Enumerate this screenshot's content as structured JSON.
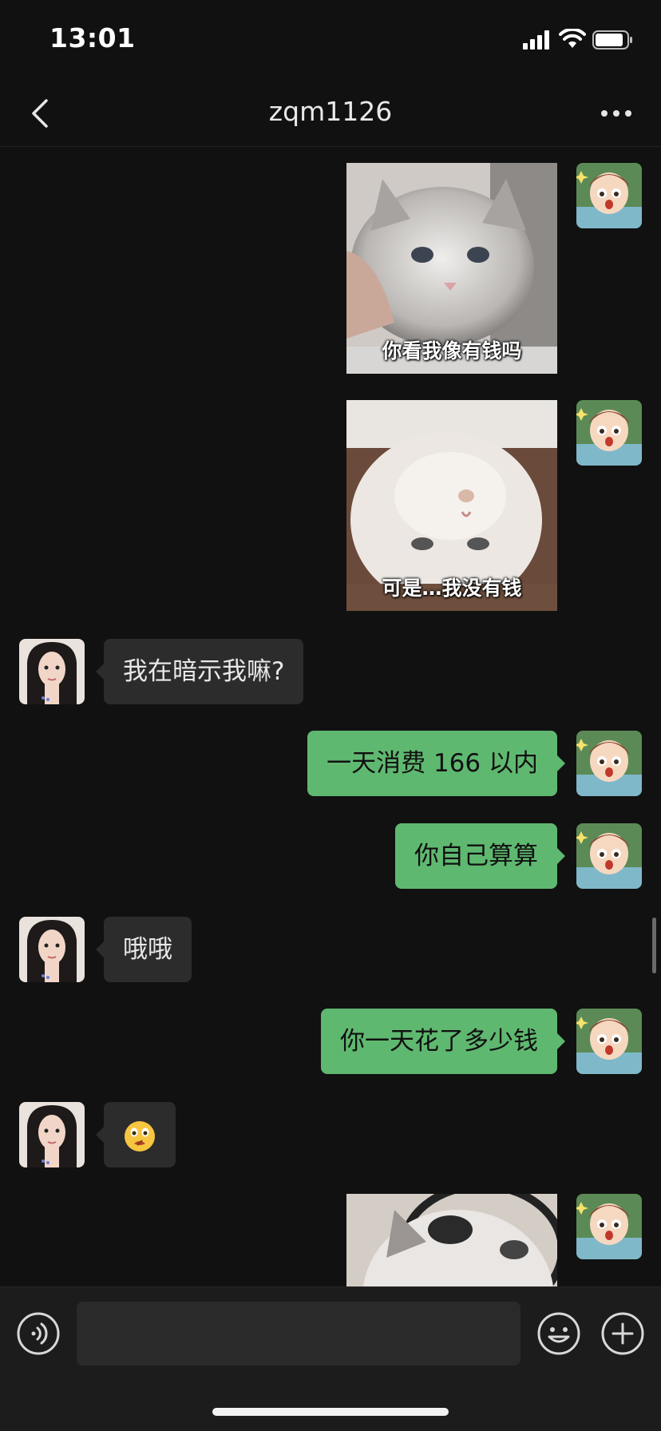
{
  "status_bar": {
    "time": "13:01"
  },
  "nav": {
    "title": "zqm1126"
  },
  "messages": [
    {
      "side": "out",
      "type": "image",
      "caption": "你看我像有钱吗"
    },
    {
      "side": "out",
      "type": "image",
      "caption": "可是…我没有钱"
    },
    {
      "side": "in",
      "type": "text",
      "text": "我在暗示我嘛?"
    },
    {
      "side": "out",
      "type": "text",
      "text": "一天消费 166 以内"
    },
    {
      "side": "out",
      "type": "text",
      "text": "你自己算算"
    },
    {
      "side": "in",
      "type": "text",
      "text": "哦哦"
    },
    {
      "side": "out",
      "type": "text",
      "text": "你一天花了多少钱"
    },
    {
      "side": "in",
      "type": "emoji",
      "icon": "zipper-mouth-face-icon"
    },
    {
      "side": "out",
      "type": "image",
      "caption": ""
    }
  ],
  "input": {
    "placeholder": ""
  },
  "colors": {
    "background": "#111111",
    "outgoing_bubble": "#5fb870",
    "incoming_bubble": "#2c2c2c",
    "input_bar": "#1c1c1c"
  }
}
